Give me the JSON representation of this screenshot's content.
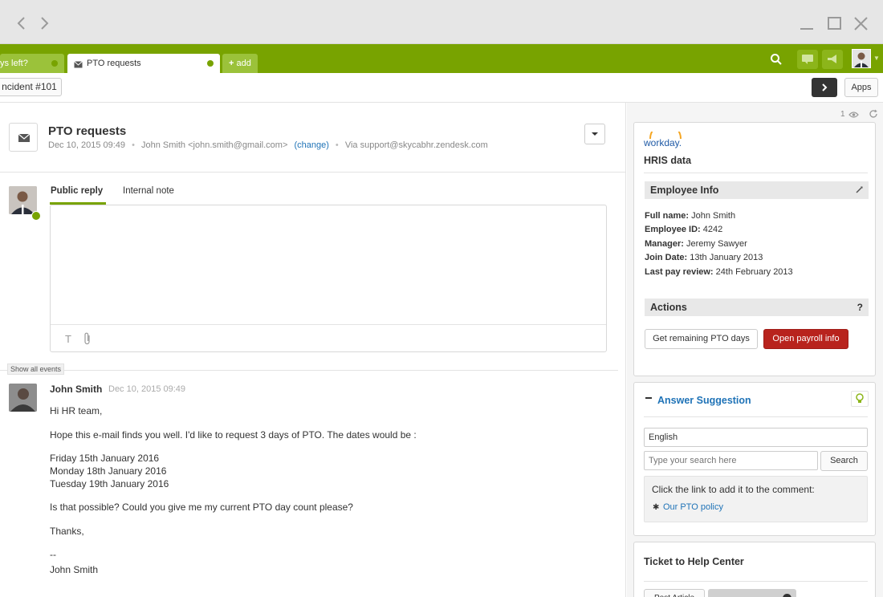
{
  "window": {
    "back_icon": "chevron-left-icon",
    "forward_icon": "chevron-right-icon",
    "minimize_icon": "minimize-icon",
    "maximize_icon": "maximize-icon",
    "close_icon": "close-icon"
  },
  "tabs": [
    {
      "label": "ys left?",
      "active": false
    },
    {
      "label": "PTO requests",
      "active": true
    },
    {
      "label": "add",
      "active": false
    }
  ],
  "toolbar": {
    "incident_label": "ncident #101",
    "apps_label": "Apps"
  },
  "ticket": {
    "title": "PTO requests",
    "date": "Dec 10, 2015 09:49",
    "requester": "John Smith <john.smith@gmail.com>",
    "change_label": "(change)",
    "via": "Via support@skycabhr.zendesk.com"
  },
  "reply": {
    "public_tab": "Public reply",
    "internal_tab": "Internal note"
  },
  "events": {
    "show_all_label": "Show all events"
  },
  "comment": {
    "author": "John Smith",
    "date": "Dec 10, 2015 09:49",
    "lines": [
      "Hi HR team,",
      "Hope this e-mail finds you well. I'd like to request 3 days of PTO. The dates would be :",
      "Friday 15th January 2016",
      "Monday 18th January 2016",
      "Tuesday 19th January 2016",
      "Is that possible? Could you give me my current PTO day count please?",
      "Thanks,",
      "--",
      "John Smith"
    ]
  },
  "sidebar": {
    "viewer_count": "1",
    "workday": {
      "logo_text": "workday.",
      "title": "HRIS data",
      "employee_info_header": "Employee Info",
      "fields": [
        {
          "label": "Full name:",
          "value": "John Smith"
        },
        {
          "label": "Employee ID:",
          "value": "4242"
        },
        {
          "label": "Manager:",
          "value": "Jeremy Sawyer"
        },
        {
          "label": "Join Date:",
          "value": "13th January 2013"
        },
        {
          "label": "Last pay review:",
          "value": "24th February 2013"
        }
      ],
      "actions_header": "Actions",
      "actions_help": "?",
      "pto_button": "Get remaining PTO days",
      "payroll_button": "Open payroll info"
    },
    "answer": {
      "title": "Answer Suggestion",
      "language": "English",
      "search_placeholder": "Type your search here",
      "search_button": "Search",
      "hint": "Click the link to add it to the comment:",
      "link": "Our PTO policy"
    },
    "help_center": {
      "title": "Ticket to Help Center",
      "post_button": "Post Article"
    }
  },
  "colors": {
    "brand_green": "#78a300",
    "tab_green": "#9bc23a",
    "link_blue": "#1f73b7",
    "danger_red": "#b8231d"
  }
}
